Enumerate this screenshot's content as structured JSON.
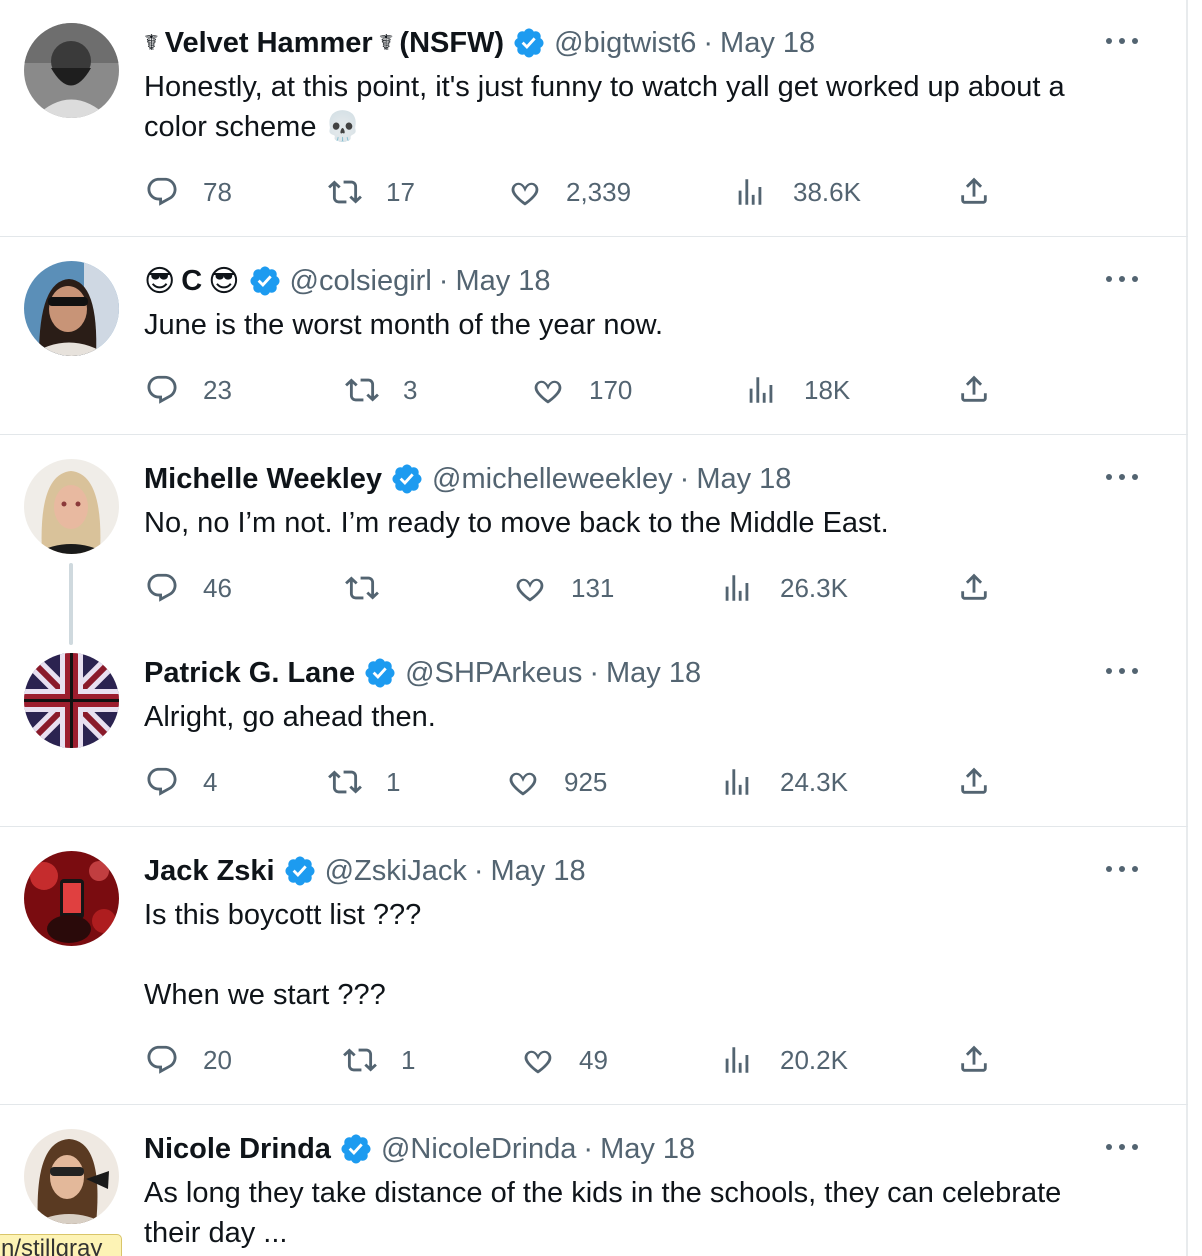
{
  "tweets": [
    {
      "name": "Velvet Hammer",
      "name_suffix": "(NSFW)",
      "name_emoji": "☤",
      "handle": "@bigtwist6",
      "separator": "·",
      "date": "May 18",
      "text_lines": [
        "Honestly, at this point, it's just funny to watch yall get worked up about a",
        "color scheme 💀"
      ],
      "replies": "78",
      "retweets": "17",
      "likes": "2,339",
      "views": "38.6K"
    },
    {
      "name": "C",
      "name_emoji": "😎",
      "handle": "@colsiegirl",
      "separator": "·",
      "date": "May 18",
      "text_lines": [
        "June is the worst month of the year now."
      ],
      "replies": "23",
      "retweets": "3",
      "likes": "170",
      "views": "18K"
    },
    {
      "name": "Michelle Weekley",
      "handle": "@michelleweekley",
      "separator": "·",
      "date": "May 18",
      "text_lines": [
        "No, no I’m not. I’m ready to move back to the Middle East."
      ],
      "replies": "46",
      "retweets": "",
      "likes": "131",
      "views": "26.3K"
    },
    {
      "name": "Patrick G. Lane",
      "handle": "@SHPArkeus",
      "separator": "·",
      "date": "May 18",
      "text_lines": [
        "Alright, go ahead then."
      ],
      "replies": "4",
      "retweets": "1",
      "likes": "925",
      "views": "24.3K"
    },
    {
      "name": "Jack Zski",
      "handle": "@ZskiJack",
      "separator": "·",
      "date": "May 18",
      "text_lines": [
        "Is this boycott list ???",
        "",
        "When we start ???"
      ],
      "replies": "20",
      "retweets": "1",
      "likes": "49",
      "views": "20.2K"
    },
    {
      "name": "Nicole Drinda",
      "handle": "@NicoleDrinda",
      "separator": "·",
      "date": "May 18",
      "text_lines": [
        "As long they take distance of the kids in the schools,  they can celebrate",
        "their day ..."
      ]
    }
  ],
  "tooltip": "n/stillgray",
  "icons": [
    "reply-icon",
    "retweet-icon",
    "like-icon",
    "views-icon",
    "share-icon",
    "verified-badge-icon",
    "more-options-icon"
  ],
  "colors": {
    "verified": "#1d9bf0",
    "secondary_text": "#536471",
    "primary_text": "#0f1419",
    "divider": "#e3e7ea"
  }
}
